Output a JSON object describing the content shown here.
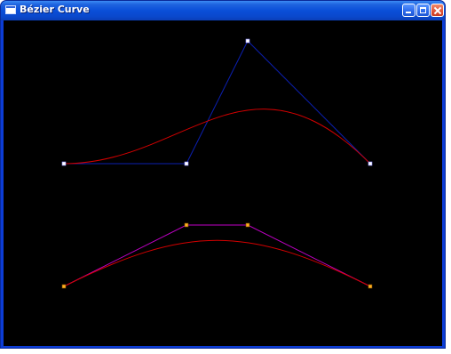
{
  "window": {
    "title": "Bézier Curve"
  },
  "icons": {
    "app": "app-icon",
    "minimize": "minimize-icon",
    "maximize": "maximize-icon",
    "close": "close-icon"
  },
  "colors": {
    "background": "#000000",
    "curve": "#d40000",
    "upper_polygon": "#0b1fb0",
    "lower_polygon": "#c200c8",
    "upper_handle": "#ffffff",
    "lower_handle": "#ffb020"
  }
}
